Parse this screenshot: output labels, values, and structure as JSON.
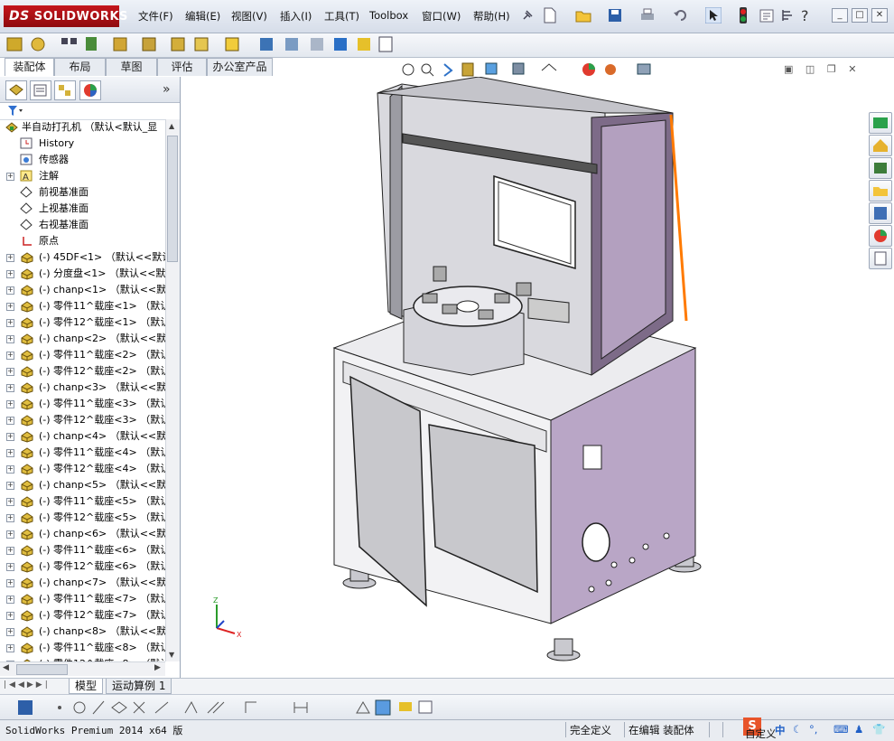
{
  "app": {
    "brand": "SOLIDWORKS",
    "brand_prefix": "DS"
  },
  "menu": [
    "文件(F)",
    "编辑(E)",
    "视图(V)",
    "插入(I)",
    "工具(T)",
    "Toolbox",
    "窗口(W)",
    "帮助(H)"
  ],
  "command_tabs": [
    "装配体",
    "布局",
    "草图",
    "评估",
    "办公室产品"
  ],
  "tree": {
    "root": "半自动打孔机 （默认<默认_显",
    "fixed": [
      {
        "label": "History",
        "icon": "history-icon",
        "expandable": false
      },
      {
        "label": "传感器",
        "icon": "sensor-icon",
        "expandable": false
      },
      {
        "label": "注解",
        "icon": "annotation-icon",
        "expandable": true
      },
      {
        "label": "前视基准面",
        "icon": "plane-icon",
        "expandable": false
      },
      {
        "label": "上视基准面",
        "icon": "plane-icon",
        "expandable": false
      },
      {
        "label": "右视基准面",
        "icon": "plane-icon",
        "expandable": false
      },
      {
        "label": "原点",
        "icon": "origin-icon",
        "expandable": false
      }
    ],
    "components": [
      "(-) 45DF<1> （默认<<默认",
      "(-) 分度盘<1> （默认<<默",
      "(-) chanp<1> （默认<<默认",
      "(-) 零件11^载座<1> （默认",
      "(-) 零件12^载座<1> （默认",
      "(-) chanp<2> （默认<<默认",
      "(-) 零件11^载座<2> （默认",
      "(-) 零件12^载座<2> （默认",
      "(-) chanp<3> （默认<<默认",
      "(-) 零件11^载座<3> （默认",
      "(-) 零件12^载座<3> （默认",
      "(-) chanp<4> （默认<<默认",
      "(-) 零件11^载座<4> （默认",
      "(-) 零件12^载座<4> （默认",
      "(-) chanp<5> （默认<<默认",
      "(-) 零件11^载座<5> （默认",
      "(-) 零件12^载座<5> （默认",
      "(-) chanp<6> （默认<<默认",
      "(-) 零件11^载座<6> （默认",
      "(-) 零件12^载座<6> （默认",
      "(-) chanp<7> （默认<<默认",
      "(-) 零件11^载座<7> （默认",
      "(-) 零件12^载座<7> （默认",
      "(-) chanp<8> （默认<<默认",
      "(-) 零件11^载座<8> （默认",
      "(-) 零件12^载座<8> （默认"
    ]
  },
  "bottom_tabs": [
    "模型",
    "运动算例 1"
  ],
  "status": {
    "product": "SolidWorks Premium 2014 x64 版",
    "definition": "完全定义",
    "editing": "在编辑 装配体",
    "custom": "自定义",
    "ime_label": "中"
  },
  "colors": {
    "cabinet_purple": "#b9a6c6",
    "enclosure_gray": "#d9d9de",
    "highlight_orange": "#ff7a00",
    "brand_red": "#c4161c"
  }
}
